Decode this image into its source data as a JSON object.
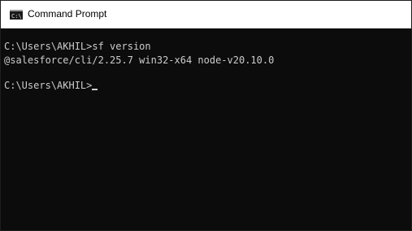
{
  "window": {
    "title": "Command Prompt",
    "icon": "cmd-icon"
  },
  "console": {
    "lines": [
      "C:\\Users\\AKHIL>sf version",
      "@salesforce/cli/2.25.7 win32-x64 node-v20.10.0",
      "C:\\Users\\AKHIL>"
    ]
  },
  "colors": {
    "console_background": "#0c0c0c",
    "console_text": "#cccccc",
    "titlebar_background": "#ffffff"
  }
}
